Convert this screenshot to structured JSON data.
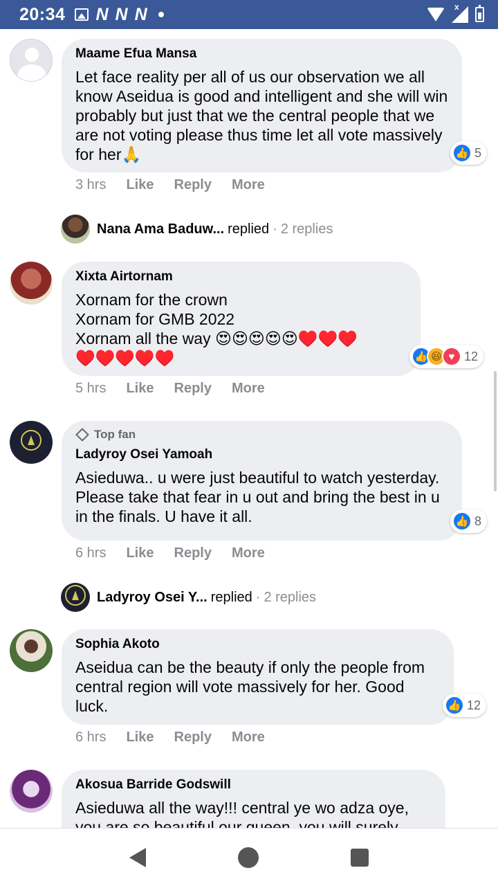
{
  "status_bar": {
    "time": "20:34",
    "notification_icons": [
      "gallery-icon",
      "N",
      "N",
      "N"
    ],
    "network_icons": [
      "wifi-icon",
      "signal-icon",
      "battery-icon"
    ],
    "signal_mark": "x"
  },
  "comments": [
    {
      "author": "Maame Efua Mansa",
      "text": "Let face reality per all of us our observation we all know Aseidua is good and intelligent and she will win probably but just that we the central people that we are not voting please thus time let all vote massively for her🙏",
      "reactions": [
        "like"
      ],
      "reaction_count": "5",
      "time": "3 hrs",
      "actions": [
        "Like",
        "Reply",
        "More"
      ],
      "replies": {
        "name": "Nana Ama Baduw...",
        "verb": "replied",
        "sep": "·",
        "count": "2 replies"
      }
    },
    {
      "author": "Xixta Airtornam",
      "text": "Xornam for the crown\nXornam for GMB 2022\nXornam all the way 😍😍😍😍😍♥️♥️♥️\n♥️♥️♥️♥️♥️",
      "reactions": [
        "like",
        "haha",
        "love"
      ],
      "reaction_count": "12",
      "time": "5 hrs",
      "actions": [
        "Like",
        "Reply",
        "More"
      ]
    },
    {
      "badge": "Top fan",
      "author": "Ladyroy Osei Yamoah",
      "text": "Asieduwa.. u were just beautiful to watch yesterday. Please take that fear in u out and bring the best in u in the finals. U have it all.",
      "reactions": [
        "like"
      ],
      "reaction_count": "8",
      "time": "6 hrs",
      "actions": [
        "Like",
        "Reply",
        "More"
      ],
      "replies": {
        "name": "Ladyroy Osei Y...",
        "verb": "replied",
        "sep": "·",
        "count": "2 replies"
      }
    },
    {
      "author": "Sophia Akoto",
      "text": "Aseidua can be the beauty if only the people from central region will vote massively for her. Good luck.",
      "reactions": [
        "like"
      ],
      "reaction_count": "12",
      "time": "6 hrs",
      "actions": [
        "Like",
        "Reply",
        "More"
      ]
    },
    {
      "author": "Akosua Barride Godswill",
      "text": "Asieduwa all the way!!! central ye wo adza oye, you are so beautiful our queen, you will surely"
    }
  ],
  "colors": {
    "status_bar": "#3b5998",
    "bubble": "#edeef1",
    "like": "#1877f2",
    "love": "#f33e58",
    "haha": "#f7b125"
  },
  "nav": {
    "back": "back-icon",
    "home": "home-icon",
    "recent": "recent-apps-icon"
  }
}
